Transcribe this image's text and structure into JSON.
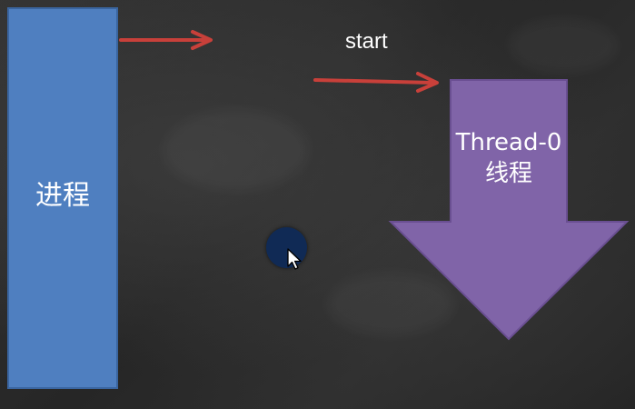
{
  "diagram": {
    "process_label": "进程",
    "start_label": "start",
    "thread_label": "Thread-0线程"
  },
  "colors": {
    "background": "#2a2a2a",
    "process_fill": "#4f7fc0",
    "thread_fill": "#8064a8",
    "arrow": "#c8403a",
    "cursor_highlight": "#102a55"
  },
  "icons": {
    "pointer": "mouse-pointer-icon"
  }
}
